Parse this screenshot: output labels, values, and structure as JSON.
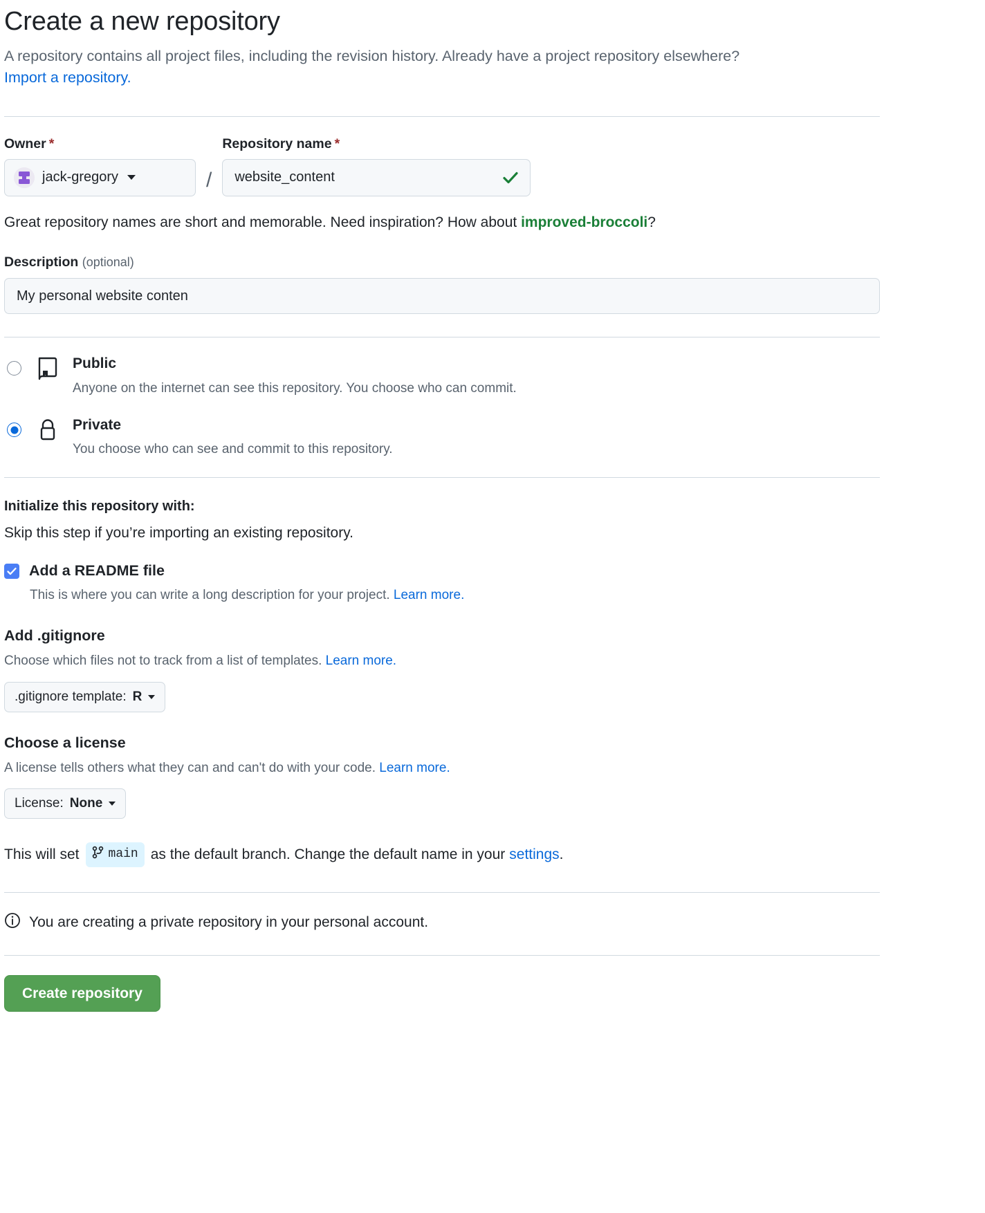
{
  "header": {
    "title": "Create a new repository",
    "subtitle": "A repository contains all project files, including the revision history. Already have a project repository elsewhere?",
    "import_link": "Import a repository."
  },
  "owner": {
    "label": "Owner",
    "required_mark": "*",
    "value": "jack-gregory",
    "avatar_icon": "user-avatar-identicon",
    "caret_icon": "chevron-down-icon"
  },
  "separator": "/",
  "repo_name": {
    "label": "Repository name",
    "required_mark": "*",
    "value": "website_content",
    "placeholder": "",
    "valid_icon": "check-icon",
    "valid_color": "#1a7f37"
  },
  "name_hint": {
    "before": "Great repository names are short and memorable. Need inspiration? How about ",
    "suggestion": "improved-broccoli",
    "after": "?"
  },
  "description": {
    "label": "Description",
    "optional": "(optional)",
    "value": "My personal website conten",
    "placeholder": ""
  },
  "visibility": [
    {
      "id": "public",
      "title": "Public",
      "desc": "Anyone on the internet can see this repository. You choose who can commit.",
      "icon": "repo-book-icon",
      "selected": false
    },
    {
      "id": "private",
      "title": "Private",
      "desc": "You choose who can see and commit to this repository.",
      "icon": "lock-icon",
      "selected": true
    }
  ],
  "initialize": {
    "heading": "Initialize this repository with:",
    "subheading": "Skip this step if you’re importing an existing repository.",
    "readme": {
      "label": "Add a README file",
      "checked": true,
      "help_before": "This is where you can write a long description for your project. ",
      "help_link": "Learn more."
    },
    "gitignore": {
      "heading": "Add .gitignore",
      "desc_before": "Choose which files not to track from a list of templates. ",
      "desc_link": "Learn more.",
      "button_prefix": ".gitignore template: ",
      "button_value": "R"
    },
    "license": {
      "heading": "Choose a license",
      "desc_before": "A license tells others what they can and can't do with your code. ",
      "desc_link": "Learn more.",
      "button_prefix": "License: ",
      "button_value": "None"
    }
  },
  "branch": {
    "before": "This will set",
    "badge_icon": "git-branch-icon",
    "badge_name": "main",
    "middle": "as the default branch. Change the default name in your",
    "link": "settings",
    "after": "."
  },
  "notice": {
    "icon": "info-icon",
    "text": "You are creating a private repository in your personal account."
  },
  "submit": {
    "label": "Create repository",
    "color": "#54a054"
  }
}
